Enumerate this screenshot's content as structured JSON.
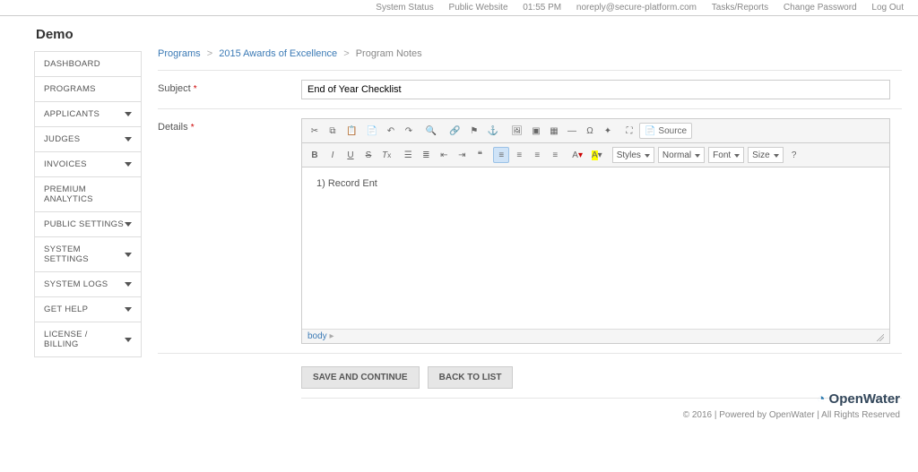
{
  "topbar": {
    "system_status": "System Status",
    "public_website": "Public Website",
    "time": "01:55 PM",
    "email": "noreply@secure-platform.com",
    "tasks_reports": "Tasks/Reports",
    "change_password": "Change Password",
    "log_out": "Log Out"
  },
  "brand": "Demo",
  "sidebar": {
    "items": [
      {
        "label": "DASHBOARD",
        "has_caret": false
      },
      {
        "label": "PROGRAMS",
        "has_caret": false
      },
      {
        "label": "APPLICANTS",
        "has_caret": true
      },
      {
        "label": "JUDGES",
        "has_caret": true
      },
      {
        "label": "INVOICES",
        "has_caret": true
      },
      {
        "label": "PREMIUM ANALYTICS",
        "has_caret": false
      },
      {
        "label": "PUBLIC SETTINGS",
        "has_caret": true
      },
      {
        "label": "SYSTEM SETTINGS",
        "has_caret": true
      },
      {
        "label": "SYSTEM LOGS",
        "has_caret": true
      },
      {
        "label": "GET HELP",
        "has_caret": true
      },
      {
        "label": "LICENSE / BILLING",
        "has_caret": true
      }
    ]
  },
  "breadcrumb": {
    "programs": "Programs",
    "awards": "2015 Awards of Excellence",
    "current": "Program Notes"
  },
  "form": {
    "subject_label": "Subject",
    "subject_value": "End of Year Checklist",
    "details_label": "Details",
    "details_body": "1) Record Ent"
  },
  "editor_toolbar": {
    "source_label": "Source",
    "styles": "Styles",
    "format": "Normal",
    "font": "Font",
    "size": "Size",
    "path": "body"
  },
  "actions": {
    "save": "SAVE AND CONTINUE",
    "back": "BACK TO LIST"
  },
  "footer": {
    "brand": "OpenWater",
    "copyright": "© 2016 | Powered by OpenWater | All Rights Reserved"
  }
}
